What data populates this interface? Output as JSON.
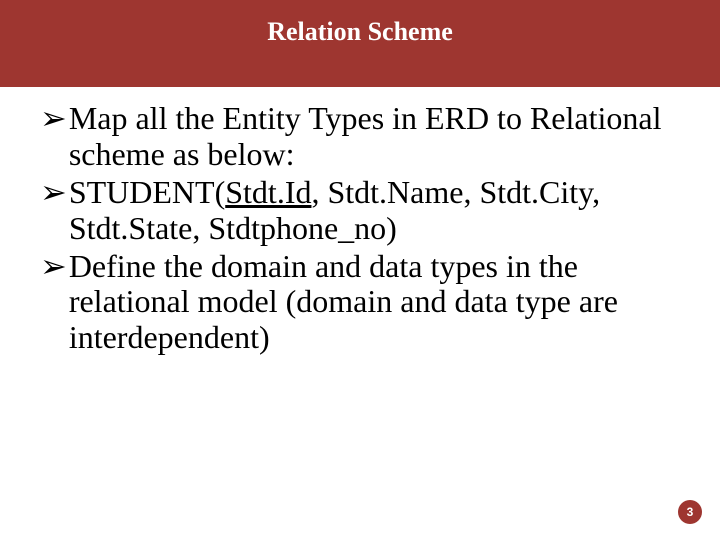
{
  "title": "Relation Scheme",
  "bullets": [
    {
      "marker": "➢",
      "segments": [
        {
          "text": "Map all the Entity Types in ERD to Relational scheme as below:",
          "underline": false
        }
      ]
    },
    {
      "marker": "➢",
      "segments": [
        {
          "text": "STUDENT(",
          "underline": false
        },
        {
          "text": "Stdt.Id",
          "underline": true
        },
        {
          "text": ", Stdt.Name, Stdt.City, Stdt.State, Stdtphone_no)",
          "underline": false
        }
      ]
    },
    {
      "marker": "➢",
      "segments": [
        {
          "text": "Define the domain and data types in the relational model (domain and data type are interdependent)",
          "underline": false
        }
      ]
    }
  ],
  "page_number": "3"
}
